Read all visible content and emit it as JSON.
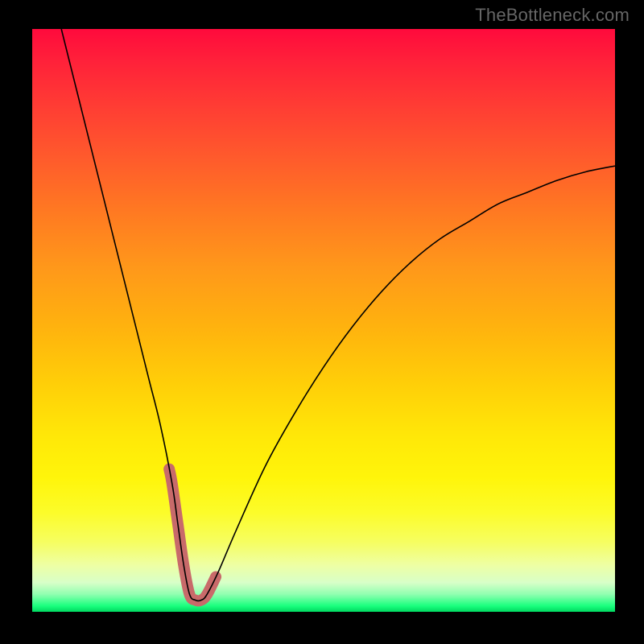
{
  "watermark": "TheBottleneck.com",
  "chart_data": {
    "type": "line",
    "title": "",
    "xlabel": "",
    "ylabel": "",
    "xlim": [
      0,
      100
    ],
    "ylim": [
      0,
      100
    ],
    "curve": {
      "x": [
        5,
        8,
        10,
        12,
        14,
        16,
        18,
        20,
        22,
        24,
        25,
        26,
        27,
        28,
        29,
        30,
        32,
        35,
        40,
        45,
        50,
        55,
        60,
        65,
        70,
        75,
        80,
        85,
        90,
        95,
        100
      ],
      "y": [
        100,
        88,
        80,
        72,
        64,
        56,
        48,
        40,
        32,
        22,
        15,
        8,
        3,
        2,
        2,
        3,
        7,
        14,
        25,
        34,
        42,
        49,
        55,
        60,
        64,
        67,
        70,
        72,
        74,
        75.5,
        76.5
      ]
    },
    "highlight_range_x": [
      23.5,
      31.5
    ],
    "gradient_stops": [
      {
        "pos": 0.0,
        "color": "#ff0a3c"
      },
      {
        "pos": 0.22,
        "color": "#ff5a2c"
      },
      {
        "pos": 0.51,
        "color": "#ffb20e"
      },
      {
        "pos": 0.77,
        "color": "#fff50a"
      },
      {
        "pos": 0.95,
        "color": "#d8ffc8"
      },
      {
        "pos": 1.0,
        "color": "#00d860"
      }
    ]
  }
}
